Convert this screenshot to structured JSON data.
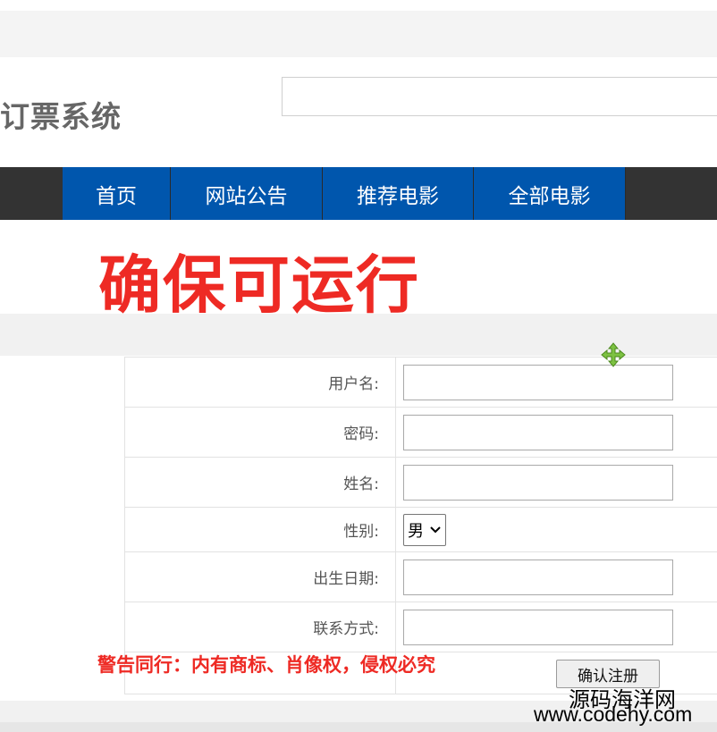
{
  "header": {
    "site_title": "订票系统",
    "search_placeholder": ""
  },
  "nav": {
    "items": [
      {
        "label": "首页"
      },
      {
        "label": "网站公告"
      },
      {
        "label": "推荐电影"
      },
      {
        "label": "全部电影"
      }
    ]
  },
  "overlay": {
    "banner": "确保可运行",
    "warning": "警告同行：内有商标、肖像权，侵权必究",
    "watermark_line1": "源码海洋网",
    "watermark_line2": "www.codehy.com"
  },
  "form": {
    "username_label": "用户名:",
    "username_value": "",
    "password_label": "密码:",
    "password_value": "",
    "name_label": "姓名:",
    "name_value": "",
    "gender_label": "性别:",
    "gender_selected": "男",
    "birthdate_label": "出生日期:",
    "birthdate_value": "",
    "contact_label": "联系方式:",
    "contact_value": "",
    "submit_label": "确认注册"
  },
  "icons": {
    "move_cursor": "move-cursor-icon"
  },
  "colors": {
    "nav_blue": "#0056ad",
    "nav_dark": "#333333",
    "warning_red": "#ee2a24"
  }
}
